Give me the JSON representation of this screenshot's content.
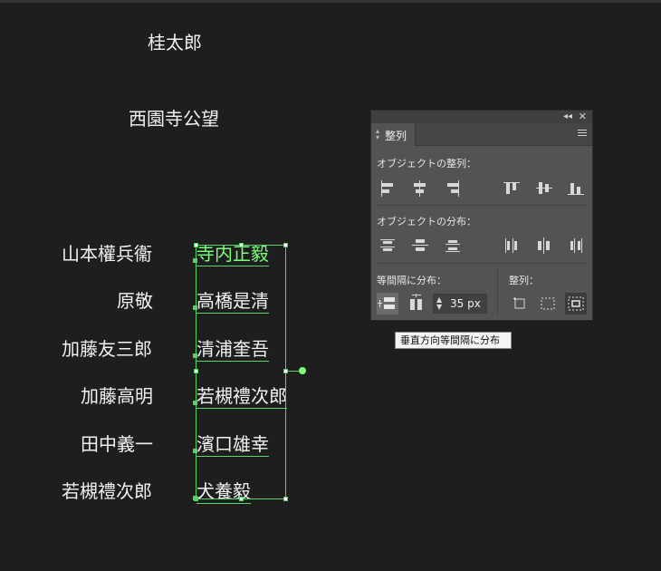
{
  "canvas": {
    "top_names": [
      "桂太郎",
      "西園寺公望"
    ],
    "left_column": [
      "山本權兵衞",
      "原敬",
      "加藤友三郎",
      "加藤高明",
      "田中義一",
      "若槻禮次郎"
    ],
    "right_column": [
      "寺内正毅",
      "高橋是清",
      "清浦奎吾",
      "若槻禮次郎",
      "濱口雄幸",
      "犬養毅"
    ]
  },
  "panel": {
    "tab_label": "整列",
    "align_objects_title": "オブジェクトの整列：",
    "distribute_objects_title": "オブジェクトの分布：",
    "distribute_spacing_title": "等間隔に分布：",
    "align_to_title": "整列：",
    "spacing_value": "35 px",
    "collapse_glyph": "◂◂",
    "close_glyph": "✕"
  },
  "tooltip": "垂直方向等間隔に分布",
  "icons": {
    "align": [
      "align-left-icon",
      "align-horizontal-center-icon",
      "align-right-icon",
      "align-top-icon",
      "align-vertical-center-icon",
      "align-bottom-icon"
    ],
    "distribute": [
      "distribute-top-icon",
      "distribute-vertical-center-icon",
      "distribute-bottom-icon",
      "distribute-left-icon",
      "distribute-horizontal-center-icon",
      "distribute-right-icon"
    ],
    "spacing": [
      "vertical-distribute-space-icon",
      "horizontal-distribute-space-icon"
    ],
    "align_to": [
      "align-to-artboard-icon",
      "align-to-selection-icon",
      "align-to-key-object-icon"
    ]
  }
}
